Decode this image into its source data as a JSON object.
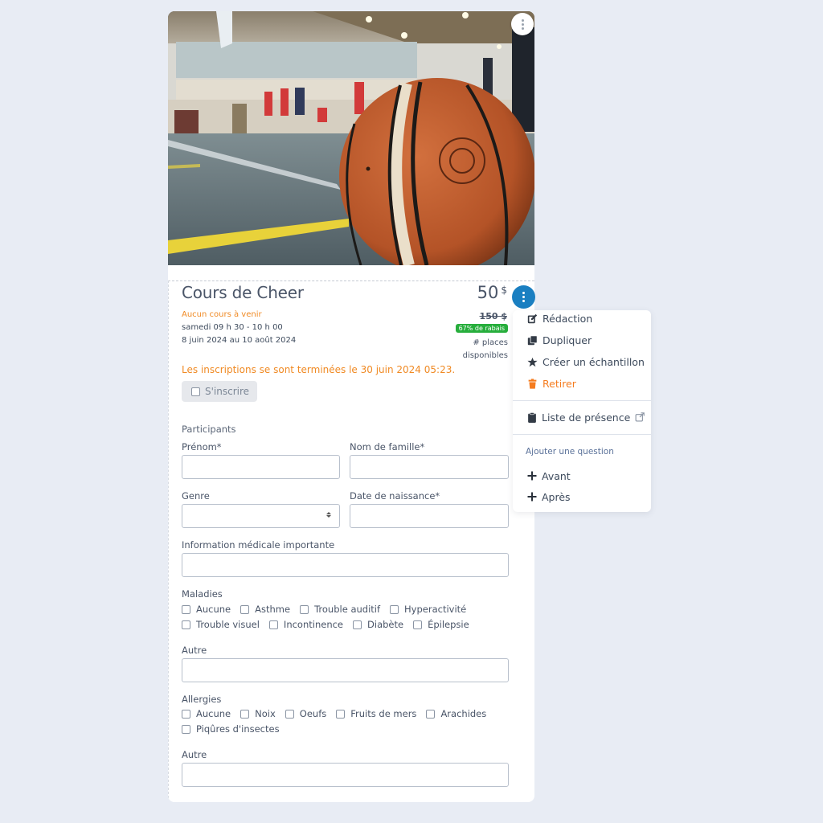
{
  "course": {
    "title": "Cours de Cheer",
    "price": "50",
    "currency": "$",
    "old_price": "150 $",
    "discount_badge": "67% de rabais",
    "places_line1": "# places",
    "places_line2": "disponibles",
    "upcoming_status": "Aucun cours à venir",
    "schedule_time": "samedi 09 h 30 - 10 h 00",
    "schedule_dates": "8 juin 2024 au 10 août 2024",
    "registration_closed": "Les inscriptions se sont terminées le 30 juin 2024 05:23.",
    "signup_label": "S'inscrire",
    "image_alt": "basketball-court-photo"
  },
  "colors": {
    "accent_blue": "#1a7fc1",
    "warning_orange": "#f08a24",
    "discount_green": "#27ae3c",
    "danger_orange": "#f57c1f"
  },
  "form": {
    "section_label": "Participants",
    "first_name_label": "Prénom*",
    "first_name_value": "",
    "last_name_label": "Nom de famille*",
    "last_name_value": "",
    "gender_label": "Genre",
    "gender_value": "",
    "birthdate_label": "Date de naissance*",
    "birthdate_value": "",
    "medical_label": "Information médicale importante",
    "medical_value": "",
    "diseases_label": "Maladies",
    "diseases": [
      "Aucune",
      "Asthme",
      "Trouble auditif",
      "Hyperactivité",
      "Trouble visuel",
      "Incontinence",
      "Diabète",
      "Épilepsie"
    ],
    "diseases_other_label": "Autre",
    "diseases_other_value": "",
    "allergies_label": "Allergies",
    "allergies": [
      "Aucune",
      "Noix",
      "Oeufs",
      "Fruits de mers",
      "Arachides",
      "Piqûres d'insectes"
    ],
    "allergies_other_label": "Autre",
    "allergies_other_value": ""
  },
  "menu": {
    "items": [
      {
        "label": "Rédaction",
        "icon": "edit-icon"
      },
      {
        "label": "Dupliquer",
        "icon": "copy-icon"
      },
      {
        "label": "Créer un échantillon",
        "icon": "star-icon"
      },
      {
        "label": "Retirer",
        "icon": "trash-icon"
      }
    ],
    "attendance_label": "Liste de présence",
    "add_question_header": "Ajouter une question",
    "before_label": "Avant",
    "after_label": "Après"
  }
}
